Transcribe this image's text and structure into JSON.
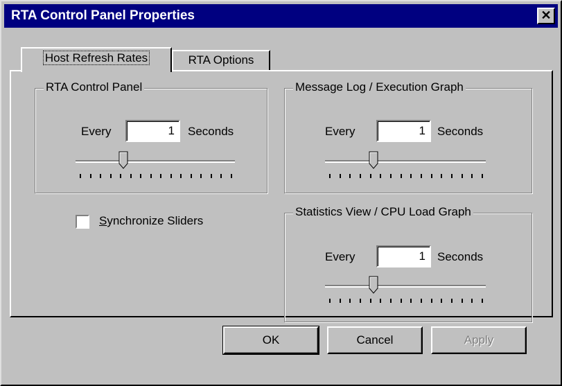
{
  "window": {
    "title": "RTA Control Panel Properties",
    "close_symbol": "✕"
  },
  "tabs": [
    {
      "label": "Host Refresh Rates",
      "active": true
    },
    {
      "label": "RTA Options",
      "active": false
    }
  ],
  "groups": {
    "rta_control_panel": {
      "label": "RTA Control Panel",
      "every_label": "Every",
      "value": "1",
      "unit": "Seconds"
    },
    "message_log": {
      "label": "Message Log / Execution Graph",
      "every_label": "Every",
      "value": "1",
      "unit": "Seconds"
    },
    "statistics_view": {
      "label": "Statistics View / CPU Load Graph",
      "every_label": "Every",
      "value": "1",
      "unit": "Seconds"
    }
  },
  "sync_sliders": {
    "accel": "S",
    "rest": "ynchronize Sliders",
    "checked": false
  },
  "buttons": {
    "ok": "OK",
    "cancel": "Cancel",
    "apply": "Apply"
  }
}
